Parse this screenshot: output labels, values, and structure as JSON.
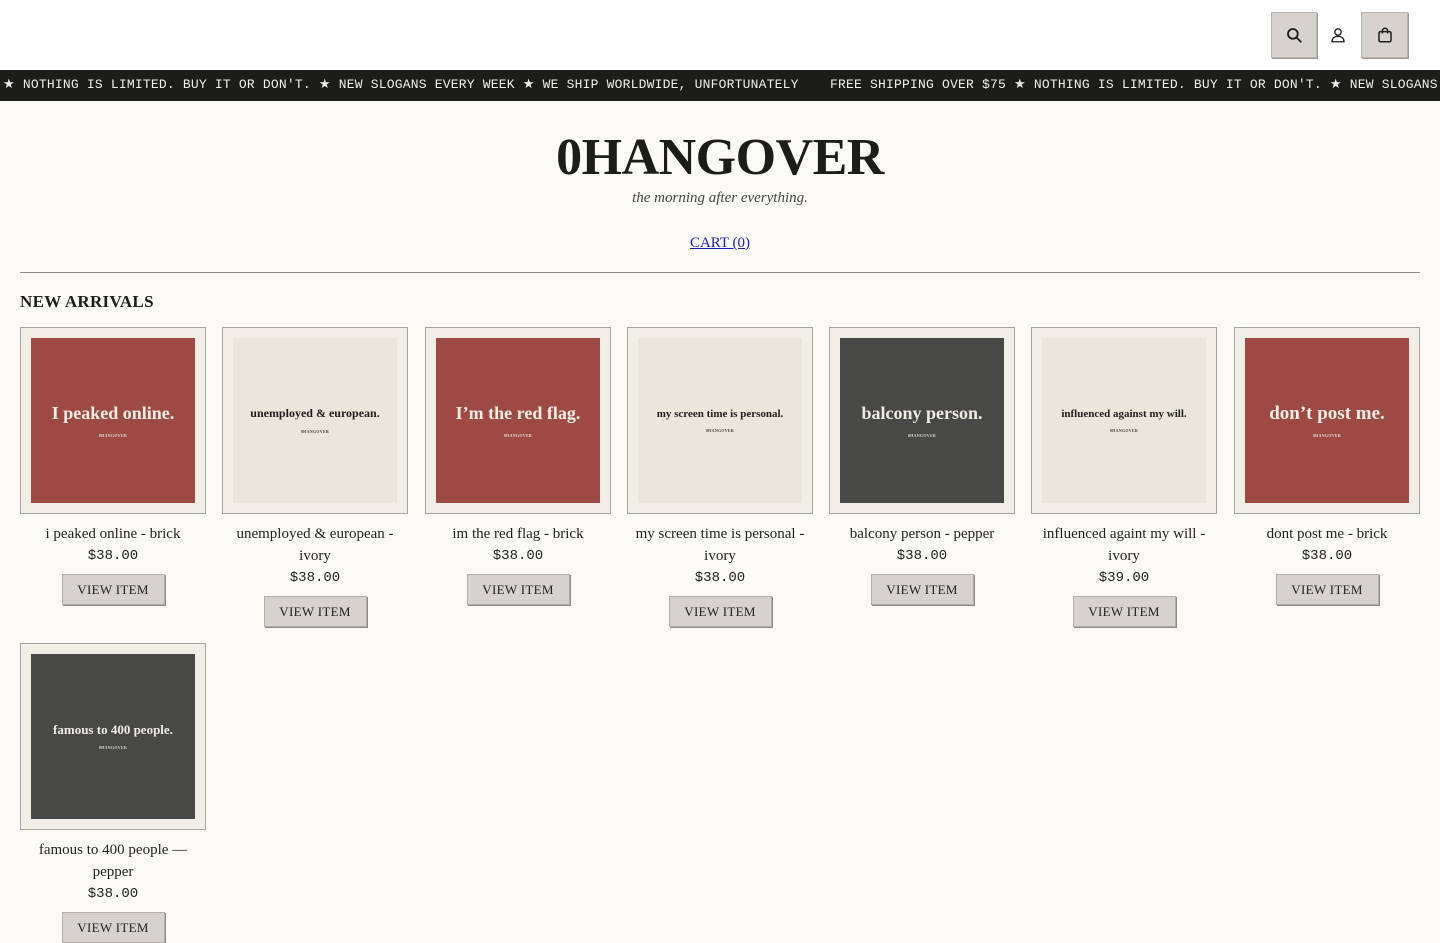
{
  "header": {
    "icons": [
      {
        "name": "search-icon",
        "label": "search"
      },
      {
        "name": "account-icon",
        "label": "account"
      },
      {
        "name": "bag-icon",
        "label": "bag"
      }
    ]
  },
  "ticker": {
    "segment_1": "★ NOTHING IS LIMITED. BUY IT OR DON'T. ★ NEW SLOGANS EVERY WEEK ★ WE SHIP WORLDWIDE, UNFORTUNATELY",
    "segment_2": "FREE SHIPPING OVER $75 ★ NOTHING IS LIMITED. BUY IT OR DON'T. ★ NEW SLOGANS E"
  },
  "brand": {
    "name": "0HANGOVER",
    "tagline": "the morning after everything."
  },
  "cart": {
    "label": "CART (0)"
  },
  "section": {
    "title": "NEW ARRIVALS"
  },
  "colors": {
    "brick": "#9c4a43",
    "ivory": "#ebe6dc",
    "pepper": "#484846"
  },
  "products": [
    {
      "slogan": "I peaked online.",
      "brand_mark": "0HANGOVER",
      "color": "brick",
      "name": "i peaked online - brick",
      "price": "$38.00",
      "button": "VIEW ITEM"
    },
    {
      "slogan": "unemployed & european.",
      "brand_mark": "0HANGOVER",
      "color": "ivory",
      "name": "unemployed & european - ivory",
      "price": "$38.00",
      "button": "VIEW ITEM"
    },
    {
      "slogan": "I’m the red flag.",
      "brand_mark": "0HANGOVER",
      "color": "brick",
      "name": "im the red flag - brick",
      "price": "$38.00",
      "button": "VIEW ITEM"
    },
    {
      "slogan": "my screen time is personal.",
      "brand_mark": "0HANGOVER",
      "color": "ivory",
      "name": "my screen time is personal - ivory",
      "price": "$38.00",
      "button": "VIEW ITEM"
    },
    {
      "slogan": "balcony person.",
      "brand_mark": "0HANGOVER",
      "color": "pepper",
      "name": "balcony person - pepper",
      "price": "$38.00",
      "button": "VIEW ITEM"
    },
    {
      "slogan": "influenced against my will.",
      "brand_mark": "0HANGOVER",
      "color": "ivory",
      "name": "influenced againt my will - ivory",
      "price": "$39.00",
      "button": "VIEW ITEM"
    },
    {
      "slogan": "don’t post me.",
      "brand_mark": "0HANGOVER",
      "color": "brick",
      "name": "dont post me - brick",
      "price": "$38.00",
      "button": "VIEW ITEM"
    },
    {
      "slogan": "famous to 400 people.",
      "brand_mark": "0HANGOVER",
      "color": "pepper",
      "name": "famous to 400 people — pepper",
      "price": "$38.00",
      "button": "VIEW ITEM"
    }
  ]
}
